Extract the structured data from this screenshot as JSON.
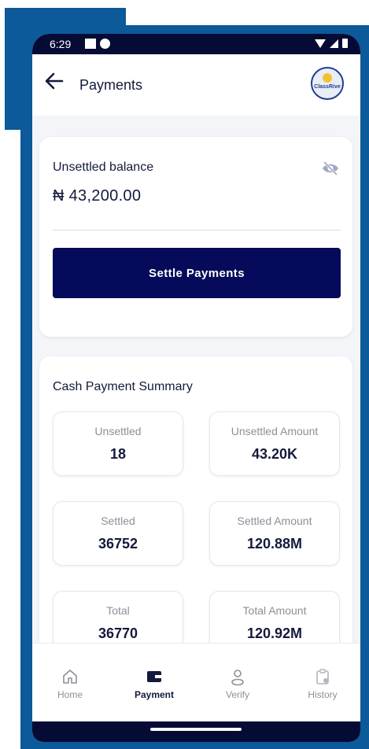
{
  "status_bar": {
    "time": "6:29"
  },
  "app_bar": {
    "title": "Payments",
    "logo_text": "ClassRive"
  },
  "balance": {
    "label": "Unsettled balance",
    "amount": "₦ 43,200.00",
    "settle_button": "Settle Payments"
  },
  "summary": {
    "title": "Cash Payment Summary",
    "stats": [
      {
        "label": "Unsettled",
        "value": "18"
      },
      {
        "label": "Unsettled Amount",
        "value": "43.20K"
      },
      {
        "label": "Settled",
        "value": "36752"
      },
      {
        "label": "Settled Amount",
        "value": "120.88M"
      },
      {
        "label": "Total",
        "value": "36770"
      },
      {
        "label": "Total Amount",
        "value": "120.92M"
      }
    ]
  },
  "nav": [
    {
      "label": "Home",
      "icon": "home-icon"
    },
    {
      "label": "Payment",
      "icon": "wallet-icon"
    },
    {
      "label": "Verify",
      "icon": "person-icon"
    },
    {
      "label": "History",
      "icon": "clipboard-icon"
    }
  ],
  "colors": {
    "primary": "#050b5a",
    "frame": "#0c5a99",
    "text": "#141a3c",
    "muted": "#8e8f98"
  }
}
